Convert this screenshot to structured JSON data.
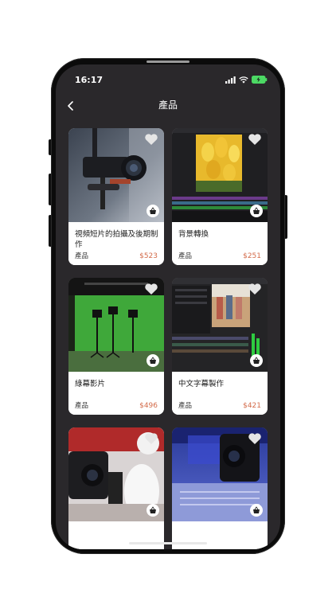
{
  "status_bar": {
    "time": "16:17"
  },
  "nav": {
    "title": "產品"
  },
  "colors": {
    "screen_bg": "#2a282b",
    "price": "#d36b4a",
    "card_bg": "#ffffff"
  },
  "products": [
    {
      "name": "視頻短片的拍攝及後期制作",
      "category": "產品",
      "price": "$523",
      "image": "camera-rig-photo"
    },
    {
      "name": "背景轉換",
      "category": "產品",
      "price": "$251",
      "image": "tulips-editing-photo"
    },
    {
      "name": "綠幕影片",
      "category": "產品",
      "price": "$496",
      "image": "green-screen-studio-photo"
    },
    {
      "name": "中文字幕製作",
      "category": "產品",
      "price": "$421",
      "image": "video-editor-screen-photo"
    },
    {
      "name": "",
      "category": "",
      "price": "",
      "image": "wedding-videographer-photo"
    },
    {
      "name": "",
      "category": "",
      "price": "",
      "image": "conference-hall-photo"
    }
  ]
}
